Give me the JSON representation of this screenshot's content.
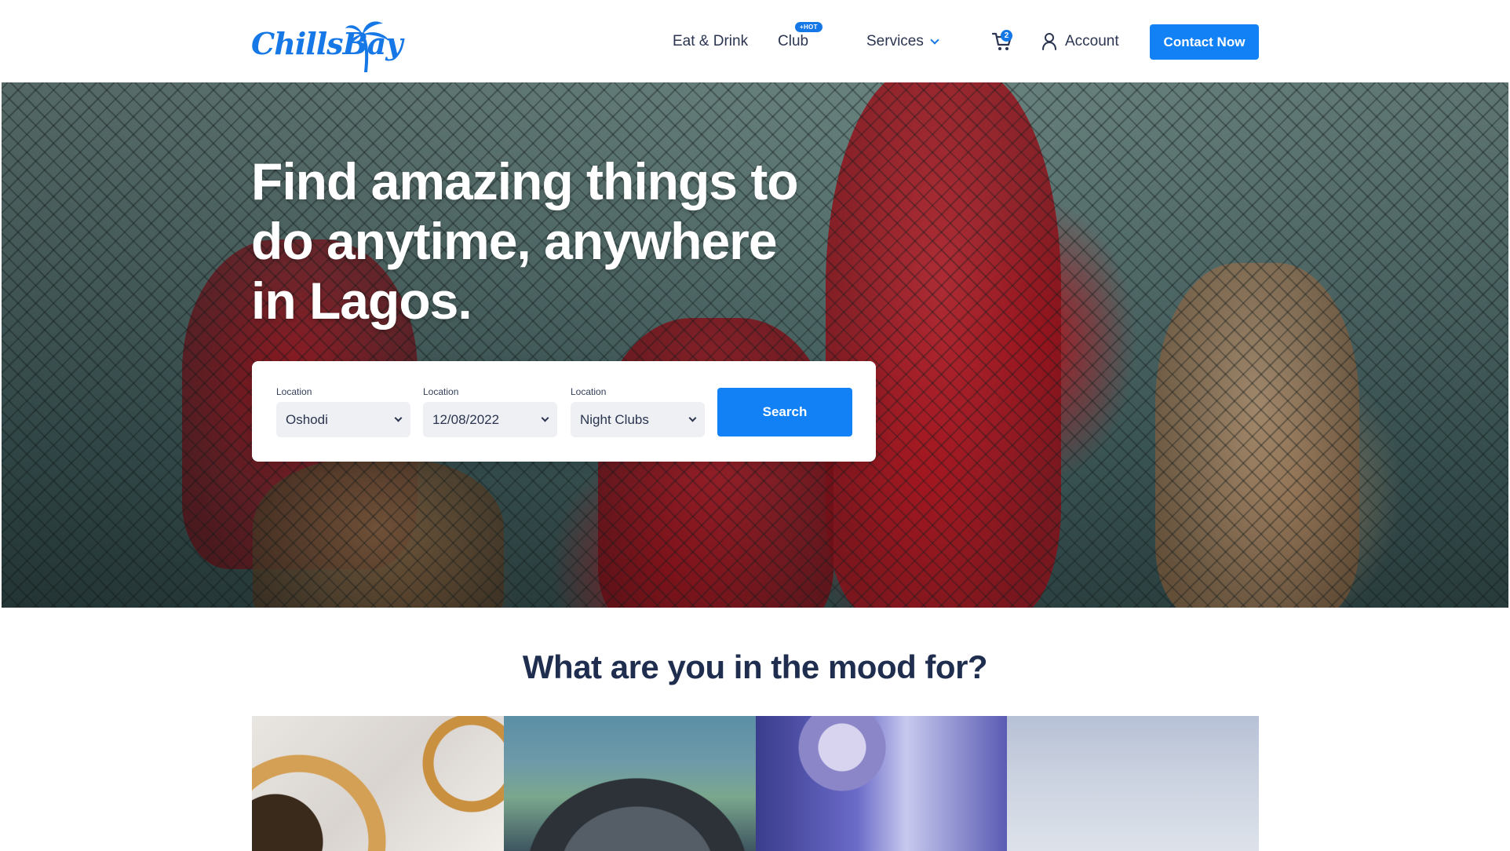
{
  "brand": {
    "name": "ChillsBay",
    "accent": "#1281f5"
  },
  "nav": {
    "items": [
      {
        "label": "Eat & Drink"
      },
      {
        "label": "Club",
        "badge": "+HOT"
      },
      {
        "label": "Services"
      }
    ],
    "cart_count": "2",
    "account_label": "Account",
    "contact_label": "Contact Now"
  },
  "hero": {
    "title": "Find amazing things to do anytime, anywhere in Lagos."
  },
  "search": {
    "fields": [
      {
        "label": "Location",
        "value": "Oshodi"
      },
      {
        "label": "Location",
        "value": "12/08/2022"
      },
      {
        "label": "Location",
        "value": "Night Clubs"
      }
    ],
    "button_label": "Search"
  },
  "mood": {
    "title": "What are you in the mood for?",
    "tiles": [
      {
        "icon": "food-plates-image"
      },
      {
        "icon": "microphone-image"
      },
      {
        "icon": "disco-ball-image"
      },
      {
        "icon": "sky-image"
      }
    ]
  }
}
